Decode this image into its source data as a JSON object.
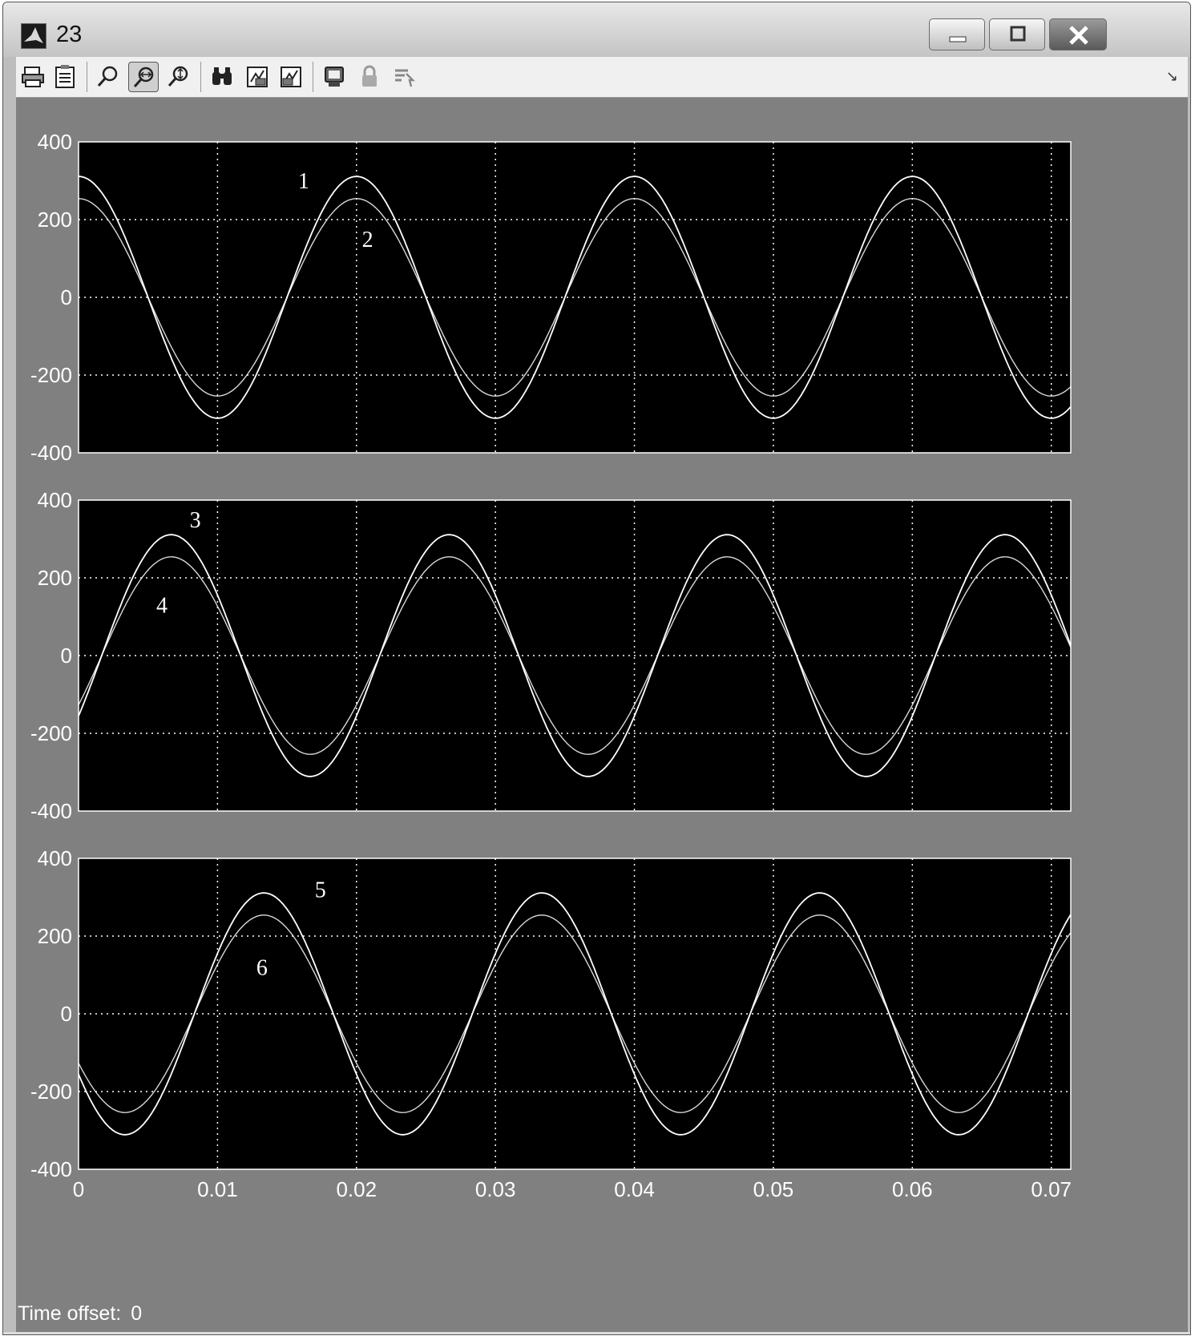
{
  "window": {
    "title": "23"
  },
  "toolbar": {
    "buttons": [
      {
        "name": "print-button",
        "icon": "printer-icon"
      },
      {
        "name": "parameters-button",
        "icon": "parameters-icon"
      },
      {
        "name": "zoom-button",
        "icon": "zoom-icon"
      },
      {
        "name": "zoom-x-button",
        "icon": "zoom-x-icon",
        "pressed": true
      },
      {
        "name": "zoom-y-button",
        "icon": "zoom-y-icon"
      },
      {
        "name": "autoscale-button",
        "icon": "binoculars-icon"
      },
      {
        "name": "save-axes-button",
        "icon": "save-axes-icon"
      },
      {
        "name": "restore-axes-button",
        "icon": "restore-axes-icon"
      },
      {
        "name": "floating-scope-button",
        "icon": "floating-scope-icon"
      },
      {
        "name": "lock-axes-button",
        "icon": "lock-icon"
      },
      {
        "name": "signal-selection-button",
        "icon": "signal-selection-icon"
      }
    ]
  },
  "status": {
    "label": "Time offset:",
    "value": "0"
  },
  "colors": {
    "plot_bg": "#000000",
    "figure_bg": "#808080",
    "trace": "#ffffff",
    "grid": "#ffffff"
  },
  "chart_data": [
    {
      "type": "line",
      "xlim": [
        0,
        0.0714
      ],
      "ylim": [
        -400,
        400
      ],
      "xticks": [
        0,
        0.01,
        0.02,
        0.03,
        0.04,
        0.05,
        0.06,
        0.07
      ],
      "yticks": [
        -400,
        -200,
        0,
        200,
        400
      ],
      "xtick_labels": [],
      "ytick_labels": [
        "-400",
        "-200",
        "0",
        "200",
        "400"
      ],
      "grid": true,
      "series": [
        {
          "amplitude": 311,
          "frequency": 50,
          "phase_deg": 90,
          "label": "1",
          "label_at": [
            0.0162,
            280
          ]
        },
        {
          "amplitude": 254,
          "frequency": 50,
          "phase_deg": 90,
          "label": "2",
          "label_at": [
            0.0208,
            130
          ]
        }
      ]
    },
    {
      "type": "line",
      "xlim": [
        0,
        0.0714
      ],
      "ylim": [
        -400,
        400
      ],
      "xticks": [
        0,
        0.01,
        0.02,
        0.03,
        0.04,
        0.05,
        0.06,
        0.07
      ],
      "yticks": [
        -400,
        -200,
        0,
        200,
        400
      ],
      "xtick_labels": [],
      "ytick_labels": [
        "-400",
        "-200",
        "0",
        "200",
        "400"
      ],
      "grid": true,
      "series": [
        {
          "amplitude": 311,
          "frequency": 50,
          "phase_deg": -30,
          "label": "3",
          "label_at": [
            0.0084,
            330
          ]
        },
        {
          "amplitude": 254,
          "frequency": 50,
          "phase_deg": -30,
          "label": "4",
          "label_at": [
            0.006,
            110
          ]
        }
      ]
    },
    {
      "type": "line",
      "xlim": [
        0,
        0.0714
      ],
      "ylim": [
        -400,
        400
      ],
      "xticks": [
        0,
        0.01,
        0.02,
        0.03,
        0.04,
        0.05,
        0.06,
        0.07
      ],
      "yticks": [
        -400,
        -200,
        0,
        200,
        400
      ],
      "xtick_labels": [
        "0",
        "0.01",
        "0.02",
        "0.03",
        "0.04",
        "0.05",
        "0.06",
        "0.07"
      ],
      "ytick_labels": [
        "-400",
        "-200",
        "0",
        "200",
        "400"
      ],
      "grid": true,
      "series": [
        {
          "amplitude": 311,
          "frequency": 50,
          "phase_deg": 210,
          "label": "5",
          "label_at": [
            0.0174,
            300
          ]
        },
        {
          "amplitude": 254,
          "frequency": 50,
          "phase_deg": 210,
          "label": "6",
          "label_at": [
            0.0132,
            100
          ]
        }
      ]
    }
  ]
}
